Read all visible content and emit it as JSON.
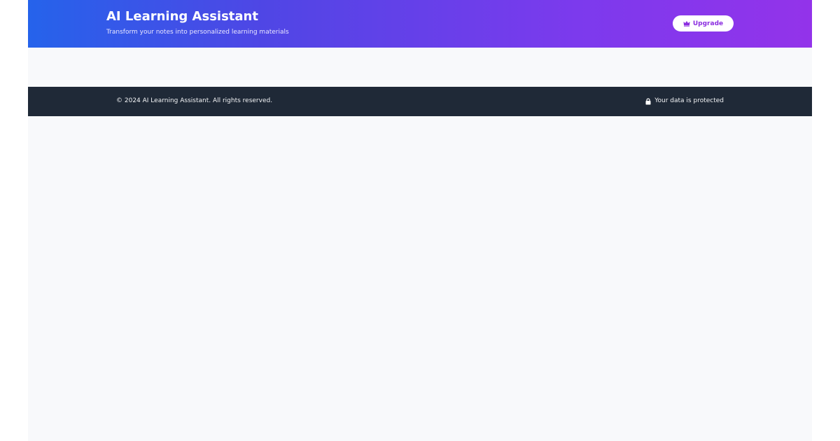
{
  "header": {
    "title": "AI Learning Assistant",
    "subtitle": "Transform your notes into personalized learning materials",
    "upgrade_label": "Upgrade",
    "upgrade_icon": "crown-icon"
  },
  "footer": {
    "copyright": "© 2024 AI Learning Assistant. All rights reserved.",
    "protected_text": "Your data is protected",
    "protected_icon": "lock-icon"
  },
  "colors": {
    "header_gradient_start": "#2563eb",
    "header_gradient_end": "#9333ea",
    "upgrade_text": "#8b2ee0",
    "footer_bg": "#1f2937",
    "page_bg": "#f8f9fb"
  }
}
